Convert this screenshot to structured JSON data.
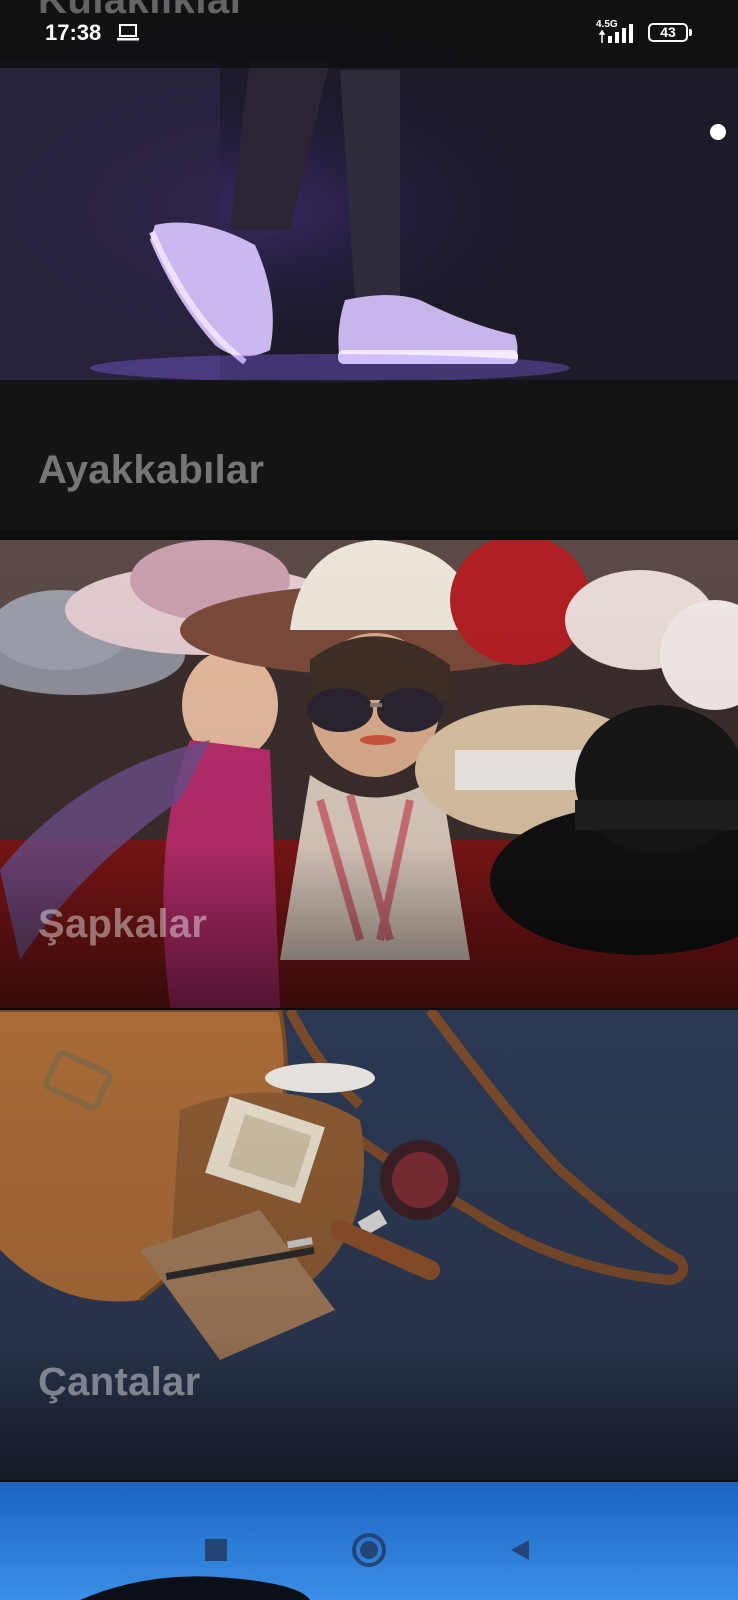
{
  "status_bar": {
    "time": "17:38",
    "network": "4.5G",
    "battery": "43",
    "peek_title": "Kulaklıklar"
  },
  "categories": [
    {
      "title": "Ayakkabılar",
      "image": "glowing-sneakers-photo"
    },
    {
      "title": "Şapkalar",
      "image": "hats-on-mannequins-photo"
    },
    {
      "title": "Çantalar",
      "image": "leather-bag-accessories-photo"
    },
    {
      "title": "",
      "image": "sunglasses-on-blue-sky-photo"
    }
  ],
  "nav": {
    "recents_icon": "square-icon",
    "home_icon": "circle-icon",
    "back_icon": "triangle-back-icon"
  },
  "colors": {
    "status_bg": "#0e0e10",
    "title_text": "#ffffff",
    "shoe_glow": "#a77bff",
    "sky_blue": "#1f73d6"
  }
}
